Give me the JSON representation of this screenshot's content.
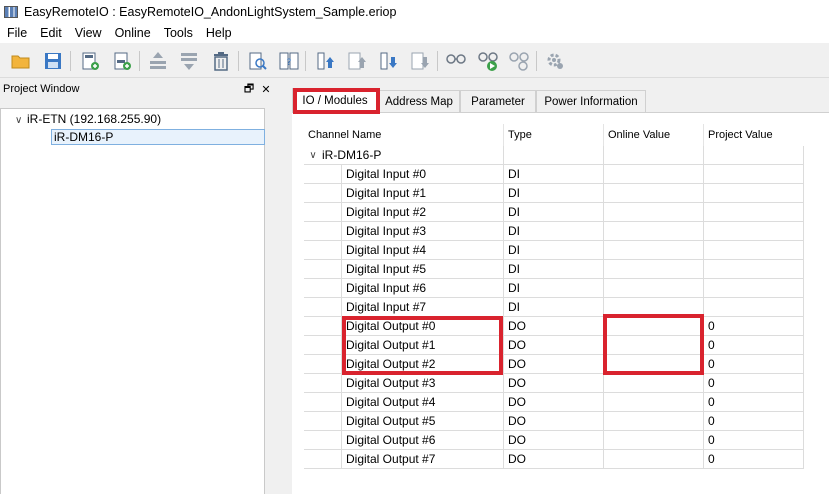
{
  "window": {
    "title": "EasyRemoteIO : EasyRemoteIO_AndonLightSystem_Sample.eriop"
  },
  "menu": [
    "File",
    "Edit",
    "View",
    "Online",
    "Tools",
    "Help"
  ],
  "toolbar": {
    "buttons": [
      "open-folder",
      "save",
      "add-device",
      "add-module",
      "move-up",
      "move-down",
      "delete",
      "search-device",
      "swap",
      "upload",
      "download-up",
      "download",
      "download-all",
      "connect",
      "run",
      "disconnect",
      "settings"
    ]
  },
  "project_window": {
    "title": "Project Window",
    "float_glyph": "🗗",
    "close_glyph": "✕",
    "tree": {
      "root": "iR-ETN (192.168.255.90)",
      "child": "iR-DM16-P"
    }
  },
  "tabs": [
    "IO / Modules",
    "Address Map",
    "Parameter",
    "Power Information"
  ],
  "active_tab": "IO / Modules",
  "table": {
    "headers": [
      "Channel Name",
      "Type",
      "Online Value",
      "Project Value"
    ],
    "group": "iR-DM16-P",
    "rows": [
      {
        "name": "Digital Input #0",
        "type": "DI",
        "online": "",
        "project": ""
      },
      {
        "name": "Digital Input #1",
        "type": "DI",
        "online": "",
        "project": ""
      },
      {
        "name": "Digital Input #2",
        "type": "DI",
        "online": "",
        "project": ""
      },
      {
        "name": "Digital Input #3",
        "type": "DI",
        "online": "",
        "project": ""
      },
      {
        "name": "Digital Input #4",
        "type": "DI",
        "online": "",
        "project": ""
      },
      {
        "name": "Digital Input #5",
        "type": "DI",
        "online": "",
        "project": ""
      },
      {
        "name": "Digital Input #6",
        "type": "DI",
        "online": "",
        "project": ""
      },
      {
        "name": "Digital Input #7",
        "type": "DI",
        "online": "",
        "project": ""
      },
      {
        "name": "Digital Output #0",
        "type": "DO",
        "online": "",
        "project": "0"
      },
      {
        "name": "Digital Output #1",
        "type": "DO",
        "online": "",
        "project": "0"
      },
      {
        "name": "Digital Output #2",
        "type": "DO",
        "online": "",
        "project": "0"
      },
      {
        "name": "Digital Output #3",
        "type": "DO",
        "online": "",
        "project": "0"
      },
      {
        "name": "Digital Output #4",
        "type": "DO",
        "online": "",
        "project": "0"
      },
      {
        "name": "Digital Output #5",
        "type": "DO",
        "online": "",
        "project": "0"
      },
      {
        "name": "Digital Output #6",
        "type": "DO",
        "online": "",
        "project": "0"
      },
      {
        "name": "Digital Output #7",
        "type": "DO",
        "online": "",
        "project": "0"
      }
    ]
  },
  "colors": {
    "highlight": "#d9232e",
    "selection": "#e8f2fc"
  }
}
